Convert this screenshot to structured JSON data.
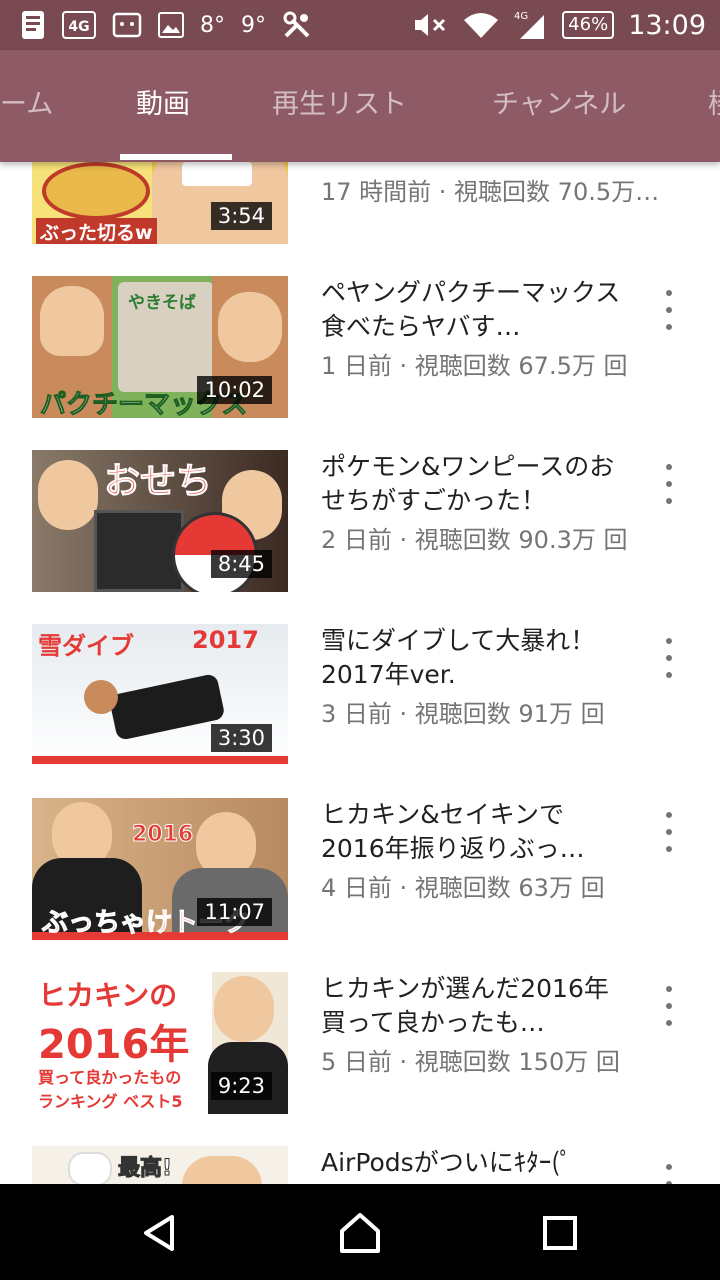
{
  "status_bar": {
    "icons_left": [
      "notification-icon",
      "four-g-icon",
      "cast-icon",
      "image-icon"
    ],
    "temp1": "8°",
    "temp2": "9°",
    "tools_icon": "tools-icon",
    "network": "4G",
    "battery": "46%",
    "time": "13:09"
  },
  "tabs": [
    "ーム",
    "動画",
    "再生リスト",
    "チャンネル",
    "楼"
  ],
  "active_tab": 1,
  "videos": [
    {
      "title": "",
      "meta": "17 時間前 · 視聴回数 70.5万…",
      "duration": "3:54",
      "thumb_text": "ぶった切るw"
    },
    {
      "title": "ペヤングパクチーマックス食べたらヤバす…",
      "meta": "1 日前 · 視聴回数 67.5万 回",
      "duration": "10:02",
      "thumb_text": "パクチーマックス",
      "thumb_sub": "やきそば"
    },
    {
      "title": "ポケモン&ワンピースのおせちがすごかった！",
      "meta": "2 日前 · 視聴回数 90.3万 回",
      "duration": "8:45",
      "thumb_text": "おせち"
    },
    {
      "title": "雪にダイブして大暴れ！2017年ver.",
      "meta": "3 日前 · 視聴回数 91万 回",
      "duration": "3:30",
      "thumb_text": "雪ダイブ",
      "thumb_year": "2017"
    },
    {
      "title": "ヒカキン&セイキンで2016年振り返りぶっ…",
      "meta": "4 日前 · 視聴回数 63万 回",
      "duration": "11:07",
      "thumb_text": "ぶっちゃけトーク",
      "thumb_year": "2016"
    },
    {
      "title": "ヒカキンが選んだ2016年買って良かったも…",
      "meta": "5 日前 · 視聴回数 150万 回",
      "duration": "9:23",
      "thumb_text": "ヒカキンの",
      "thumb_year": "2016年",
      "thumb_sub": "買って良かったもの",
      "thumb_sub2": "ランキング ベスト5"
    },
    {
      "title": "AirPodsがついにｷﾀｰ(ﾟ",
      "meta": "",
      "duration": "",
      "thumb_text": "最高!"
    }
  ],
  "nav": [
    "back-icon",
    "home-icon",
    "recents-icon"
  ]
}
